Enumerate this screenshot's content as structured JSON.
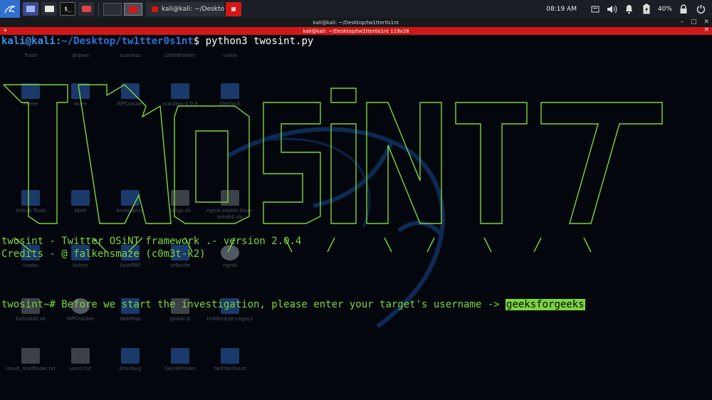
{
  "panel": {
    "clock": "08:19 AM",
    "battery": "40%",
    "task_label": "kali@kali: ~/Desktop/tw"
  },
  "window": {
    "tab_title": "kali@kali: ~/Desktop/tw1tter0s1nt",
    "title": "kali@kali: ~/Desktop/tw1tter0s1nt 119x28"
  },
  "terminal": {
    "prompt_user": "kali@kali",
    "prompt_sep": ":",
    "prompt_path": "~/Desktop/tw1tter0s1nt",
    "prompt_symbol": "$",
    "command": " python3 twosint.py",
    "version_line": "twosint - Twitter OSiNT framework .- version 2.0.4",
    "credits_line": "Credits - @ falkensmaze (c0m3t-k2)",
    "input_prompt": "twosint~# Before we start the investigation, please enter your target's username -> ",
    "input_value": "geeksforgeeks"
  },
  "desktop_icons": [
    {
      "label": "Trash",
      "kind": "plain"
    },
    {
      "label": "dirpwn",
      "kind": "plain"
    },
    {
      "label": "scanless",
      "kind": "plain"
    },
    {
      "label": "LittleBrother",
      "kind": "plain"
    },
    {
      "label": "vulnx",
      "kind": "plain"
    },
    {
      "label": "Home",
      "kind": "folder"
    },
    {
      "label": "xsser",
      "kind": "folder"
    },
    {
      "label": "WPCracker",
      "kind": "folder"
    },
    {
      "label": "scanless-1.0.6",
      "kind": "folder"
    },
    {
      "label": "sherlock",
      "kind": "folder"
    },
    {
      "label": "Article Tools",
      "kind": "folder"
    },
    {
      "label": "bbht",
      "kind": "folder"
    },
    {
      "label": "brutespray",
      "kind": "folder"
    },
    {
      "label": "pingo.sh",
      "kind": "file"
    },
    {
      "label": "ngrok-stable-linux-amd64.zip",
      "kind": "file"
    },
    {
      "label": "naabu",
      "kind": "folder"
    },
    {
      "label": "Vulnnr",
      "kind": "folder"
    },
    {
      "label": "0xWPBF",
      "kind": "folder"
    },
    {
      "label": "urlbrute",
      "kind": "folder"
    },
    {
      "label": "ngrok",
      "kind": "gear"
    },
    {
      "label": "kalinstall.sh",
      "kind": "file"
    },
    {
      "label": "WPCracker",
      "kind": "gear"
    },
    {
      "label": "WebMap",
      "kind": "folder"
    },
    {
      "label": "global.js",
      "kind": "file"
    },
    {
      "label": "HiddenEye-Legacy",
      "kind": "folder"
    },
    {
      "label": "result_mailfinder.txt",
      "kind": "file"
    },
    {
      "label": "users.txt",
      "kind": "file"
    },
    {
      "label": "JitterBug",
      "kind": "folder"
    },
    {
      "label": "SecretFinder",
      "kind": "folder"
    },
    {
      "label": "tw1tter0s1nt",
      "kind": "folder"
    }
  ],
  "colors": {
    "accent_red": "#d01818",
    "term_green": "#7dd43c",
    "prompt_blue": "#2c6fd6"
  }
}
